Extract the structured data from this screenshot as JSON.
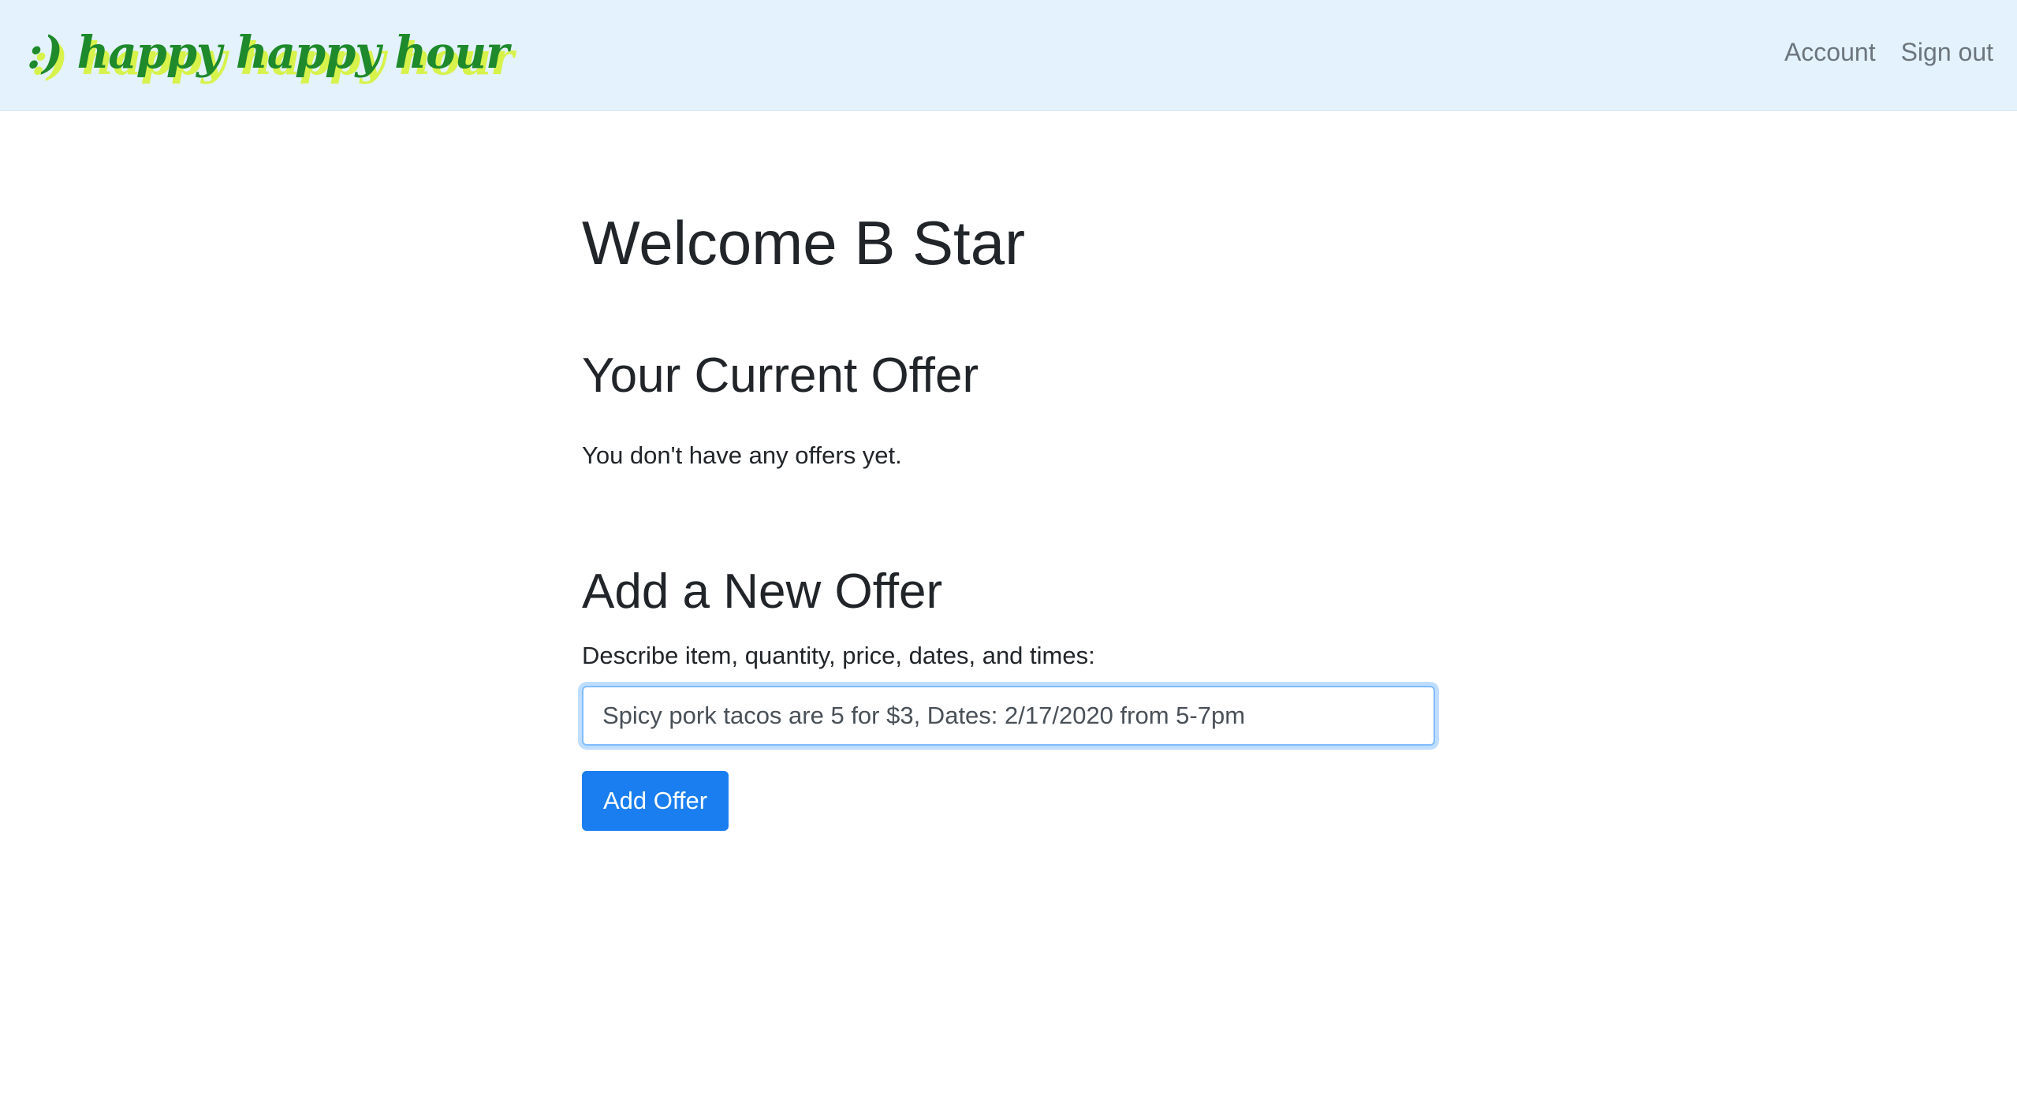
{
  "navbar": {
    "brand": ":) happy happy hour",
    "links": [
      {
        "label": "Account"
      },
      {
        "label": "Sign out"
      }
    ]
  },
  "main": {
    "welcome": "Welcome B Star",
    "current_offer_heading": "Your Current Offer",
    "no_offers_text": "You don't have any offers yet.",
    "add_offer_heading": "Add a New Offer",
    "field_label": "Describe item, quantity, price, dates, and times:",
    "offer_input_value": "Spicy pork tacos are 5 for $3, Dates: 2/17/2020 from 5-7pm",
    "add_button_label": "Add Offer"
  },
  "colors": {
    "navbar_bg": "#e3f2fd",
    "brand_green": "#1e8a2c",
    "brand_shadow": "#d7f24a",
    "primary_button": "#1a7ef0"
  }
}
